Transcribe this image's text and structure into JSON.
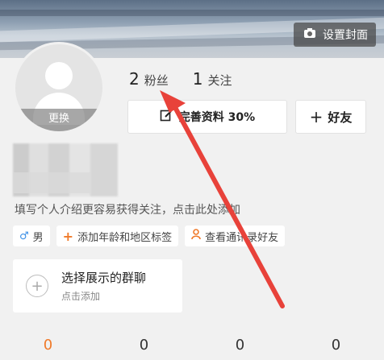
{
  "cover": {
    "set_cover_label": "设置封面",
    "set_cover_icon": "camera-icon"
  },
  "avatar": {
    "change_label": "更换"
  },
  "stats": [
    {
      "num": "2",
      "label": "粉丝"
    },
    {
      "num": "1",
      "label": "关注"
    }
  ],
  "buttons": {
    "complete_profile": "完善资料 30%",
    "add_friend": "好友"
  },
  "intro_text": "填写个人介绍更容易获得关注，点击此处添加",
  "tags": [
    {
      "icon": "male-icon",
      "glyph": "♂",
      "label": "男"
    },
    {
      "icon": "plus-icon",
      "glyph": "+",
      "label": "添加年龄和地区标签"
    },
    {
      "icon": "contacts-icon",
      "glyph": "♙",
      "label": "查看通讯录好友"
    }
  ],
  "group_chat": {
    "title": "选择展示的群聊",
    "subtitle": "点击添加"
  },
  "counts": [
    "0",
    "0",
    "0",
    "0"
  ],
  "colors": {
    "accent": "#f07a2a",
    "male": "#3a8ee6",
    "arrow": "#e8423a"
  }
}
